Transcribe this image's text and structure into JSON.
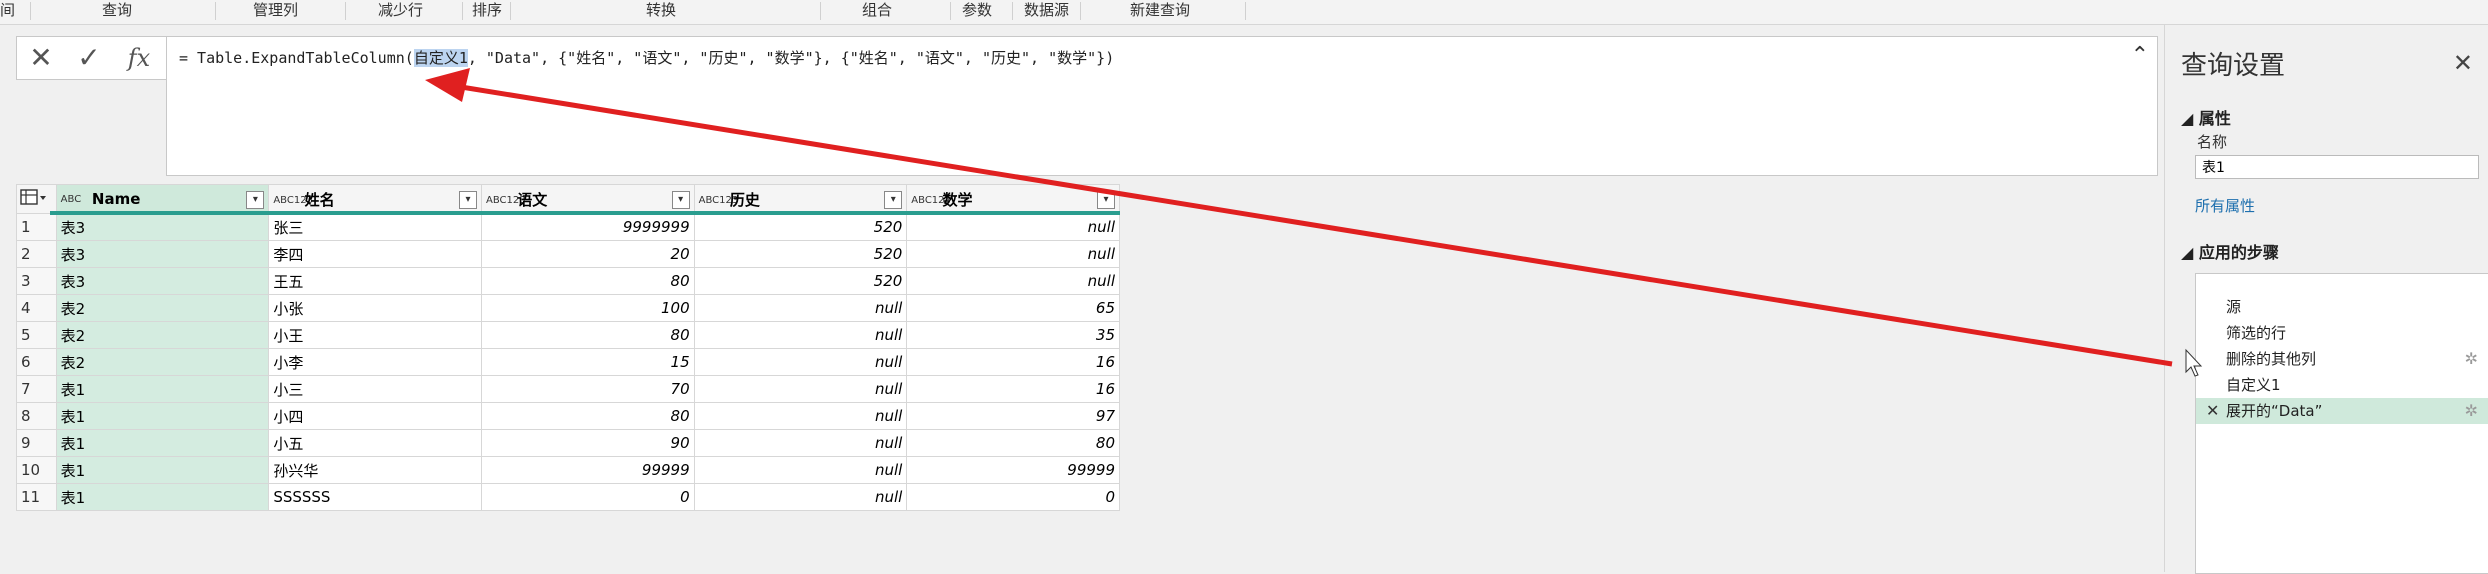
{
  "ribbon": {
    "groups": [
      "查询",
      "管理列",
      "减少行",
      "排序",
      "转换",
      "组合",
      "参数",
      "数据源",
      "新建查询"
    ]
  },
  "formula": {
    "cancel_icon": "✕",
    "confirm_icon": "✓",
    "fx_label": "fx",
    "before": "= Table.ExpandTableColumn(",
    "highlight": "自定义1",
    "after": ", \"Data\", {\"姓名\", \"语文\", \"历史\", \"数学\"}, {\"姓名\", \"语文\", \"历史\", \"数学\"})",
    "collapse_icon": "⌃"
  },
  "table": {
    "columns": [
      {
        "type": "ABC",
        "name": "Name"
      },
      {
        "type": "ABC123",
        "name": "姓名"
      },
      {
        "type": "ABC123",
        "name": "语文"
      },
      {
        "type": "ABC123",
        "name": "历史"
      },
      {
        "type": "ABC123",
        "name": "数学"
      }
    ],
    "rows": [
      [
        "1",
        "表3",
        "张三",
        "9999999",
        "520",
        "null"
      ],
      [
        "2",
        "表3",
        "李四",
        "20",
        "520",
        "null"
      ],
      [
        "3",
        "表3",
        "王五",
        "80",
        "520",
        "null"
      ],
      [
        "4",
        "表2",
        "小张",
        "100",
        "null",
        "65"
      ],
      [
        "5",
        "表2",
        "小王",
        "80",
        "null",
        "35"
      ],
      [
        "6",
        "表2",
        "小李",
        "15",
        "null",
        "16"
      ],
      [
        "7",
        "表1",
        "小三",
        "70",
        "null",
        "16"
      ],
      [
        "8",
        "表1",
        "小四",
        "80",
        "null",
        "97"
      ],
      [
        "9",
        "表1",
        "小五",
        "90",
        "null",
        "80"
      ],
      [
        "10",
        "表1",
        "孙兴华",
        "99999",
        "null",
        "99999"
      ],
      [
        "11",
        "表1",
        "SSSSSS",
        "0",
        "null",
        "0"
      ]
    ]
  },
  "sidebar": {
    "title": "查询设置",
    "properties_header": "属性",
    "name_label": "名称",
    "name_value": "表1",
    "all_properties_link": "所有属性",
    "applied_steps_header": "应用的步骤",
    "steps": [
      {
        "label": "源",
        "gear": false,
        "selected": false
      },
      {
        "label": "筛选的行",
        "gear": false,
        "selected": false
      },
      {
        "label": "删除的其他列",
        "gear": true,
        "selected": false
      },
      {
        "label": "自定义1",
        "gear": false,
        "selected": false
      },
      {
        "label": "展开的“Data”",
        "gear": true,
        "selected": true
      }
    ]
  },
  "colors": {
    "accent_green": "#cfe9db",
    "arrow_red": "#e02020",
    "teal_bar": "#2a9d8f"
  }
}
